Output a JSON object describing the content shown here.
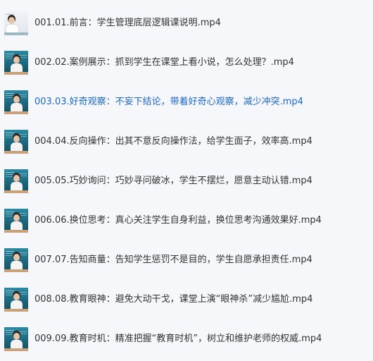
{
  "file_list": {
    "items": [
      {
        "name": "001.01.前言：学生管理底层逻辑课说明.mp4",
        "thumbnail": "video-thumbnail-teacher-whiteboard",
        "active": false
      },
      {
        "name": "002.02.案例展示：抓到学生在课堂上看小说，怎么处理？.mp4",
        "thumbnail": "video-thumbnail-teacher-blackboard",
        "active": false
      },
      {
        "name": "003.03.好奇观察：不妄下结论，带着好奇心观察，减少冲突.mp4",
        "thumbnail": "video-thumbnail-teacher-blackboard",
        "active": true
      },
      {
        "name": "004.04.反向操作：出其不意反向操作法，给学生面子，效率高.mp4",
        "thumbnail": "video-thumbnail-teacher-blackboard",
        "active": false
      },
      {
        "name": "005.05.巧妙询问：巧妙寻问破冰，学生不摆烂，愿意主动认错.mp4",
        "thumbnail": "video-thumbnail-teacher-blackboard",
        "active": false
      },
      {
        "name": "006.06.换位思考：真心关注学生自身利益，换位思考沟通效果好.mp4",
        "thumbnail": "video-thumbnail-teacher-blackboard",
        "active": false
      },
      {
        "name": "007.07.告知商量：告知学生惩罚不是目的，学生自愿承担责任.mp4",
        "thumbnail": "video-thumbnail-teacher-blackboard",
        "active": false
      },
      {
        "name": "008.08.教育眼神：避免大动干戈，课堂上演“眼神杀”减少尴尬.mp4",
        "thumbnail": "video-thumbnail-teacher-blackboard",
        "active": false
      },
      {
        "name": "009.09.教育时机：精准把握“教育时机”，树立和维护老师的权威.mp4",
        "thumbnail": "video-thumbnail-teacher-blackboard",
        "active": false
      }
    ]
  },
  "colors": {
    "background": "#f6f7fb",
    "text": "#333333",
    "active_text": "#1a66c9"
  }
}
